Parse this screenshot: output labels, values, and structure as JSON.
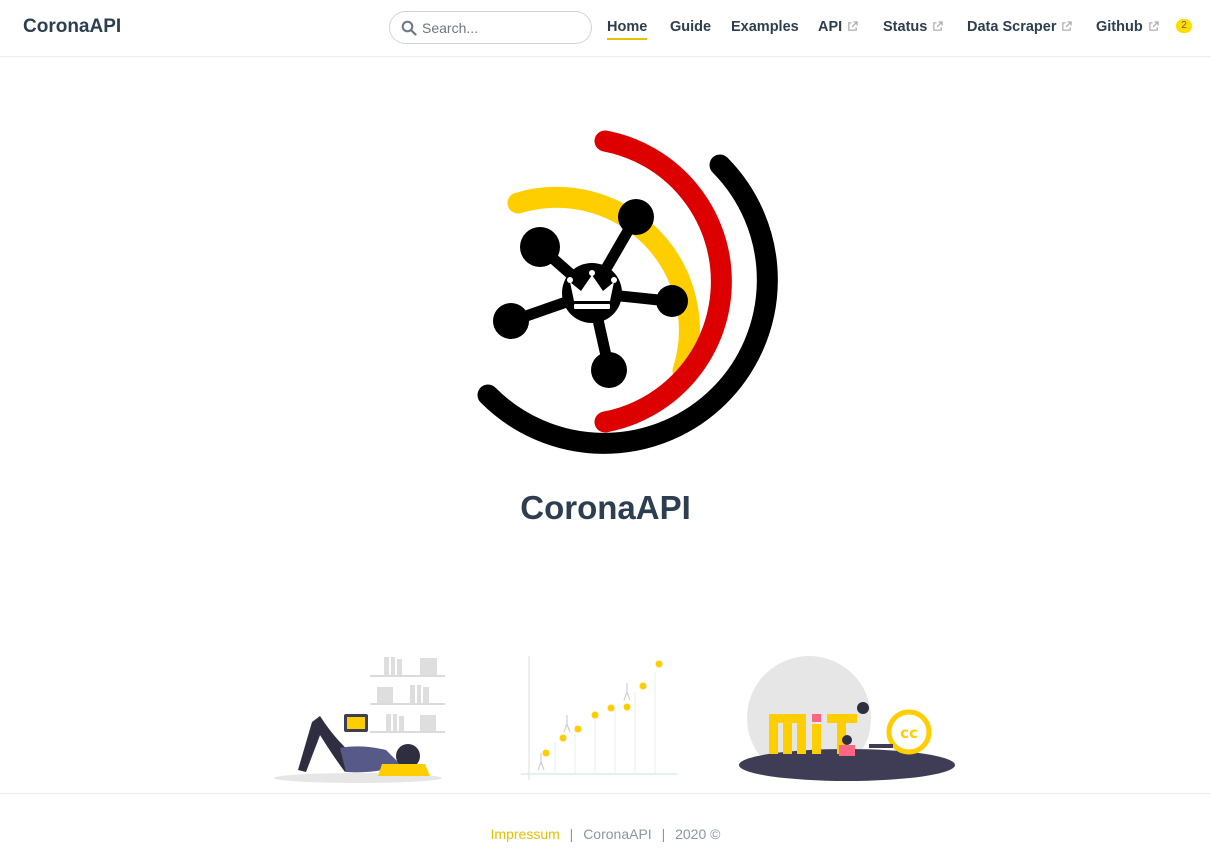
{
  "navbar": {
    "site_name": "CoronaAPI",
    "search_placeholder": "Search...",
    "links": [
      {
        "label": "Home",
        "external": false,
        "active": true
      },
      {
        "label": "Guide",
        "external": false,
        "active": false
      },
      {
        "label": "Examples",
        "external": false,
        "active": false
      },
      {
        "label": "API",
        "external": true,
        "active": false
      },
      {
        "label": "Status",
        "external": true,
        "active": false
      },
      {
        "label": "Data Scraper",
        "external": true,
        "active": false
      },
      {
        "label": "Github",
        "external": true,
        "active": false
      }
    ],
    "badge_count": "2"
  },
  "hero": {
    "logo_icon": "network-crown-logo",
    "title": "CoronaAPI"
  },
  "features": [
    {
      "icon": "reading-person-illustration"
    },
    {
      "icon": "growth-chart-illustration"
    },
    {
      "icon": "mit-cc-license-illustration"
    }
  ],
  "footer": {
    "impressum": "Impressum",
    "separator": "|",
    "brand": "CoronaAPI",
    "year": "2020 ©"
  },
  "colors": {
    "accent": "#ffcc00",
    "flag_black": "#000000",
    "flag_red": "#dd0000",
    "flag_gold": "#ffce00",
    "text": "#2c3e50",
    "footer_text": "#8a96a3"
  }
}
